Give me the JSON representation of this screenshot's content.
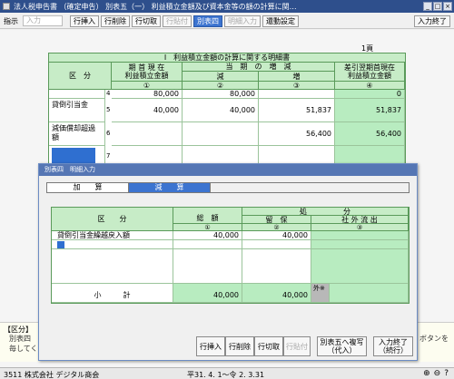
{
  "window": {
    "title": "法人税申告書 （確定申告） 別表五（一） 利益積立金額及び資本金等の額の計算に関…",
    "controls": [
      "_",
      "□",
      "×"
    ]
  },
  "toolbar": {
    "display_label": "指示",
    "input_placeholder": "入力",
    "buttons": [
      {
        "label": "行挿入",
        "state": "normal"
      },
      {
        "label": "行削除",
        "state": "normal"
      },
      {
        "label": "行切取",
        "state": "normal"
      },
      {
        "label": "行貼付",
        "state": "disabled"
      },
      {
        "label": "別表四",
        "state": "active"
      },
      {
        "label": "明細入力",
        "state": "disabled"
      },
      {
        "label": "還動設定",
        "state": "normal"
      }
    ],
    "finish_button": "入力終了"
  },
  "sheet": {
    "page": "1頁",
    "title": "Ⅰ　利益積立金額の計算に関する明細書",
    "headers": {
      "category": "区　分",
      "opening": "期 首 現 在\n利益積立金額",
      "change": "当　期　の　増　減",
      "decrease": "減",
      "increase": "増",
      "closing": "差引翌期首現在\n利益積立金額",
      "col1": "①",
      "col2": "②",
      "col3": "③",
      "col4": "④"
    },
    "rows": [
      {
        "no": "4",
        "label": "",
        "opening": "80,000",
        "decrease": "80,000",
        "increase": "",
        "closing": "0"
      },
      {
        "no": "5",
        "label": "貸倒引当金",
        "opening": "40,000",
        "decrease": "40,000",
        "increase": "51,837",
        "closing": "51,837"
      },
      {
        "no": "6",
        "label": "減価償却超過額",
        "opening": "",
        "decrease": "",
        "increase": "56,400",
        "closing": "56,400"
      },
      {
        "no": "7",
        "label": "",
        "opening": "",
        "decrease": "",
        "increase": "",
        "closing": ""
      }
    ]
  },
  "dialog": {
    "title": "別表四　明細入力",
    "tabs": [
      "加　　算",
      "減　　算"
    ],
    "headers": {
      "category": "区　　分",
      "total": "総　額",
      "disposal": "処　　　　　分",
      "retained": "留　保",
      "outflow": "社 外 流 出",
      "c1": "①",
      "c2": "②",
      "c3": "③"
    },
    "rows": [
      {
        "label": "貸倒引当金繰越戻入額",
        "total": "40,000",
        "retained": "40,000",
        "outflow": ""
      },
      {
        "label": "",
        "total": "",
        "retained": "",
        "outflow": ""
      }
    ],
    "subtotal": {
      "label": "小　　　計",
      "total": "40,000",
      "retained": "40,000",
      "outflow_tag": "外※"
    },
    "buttons": {
      "insert": "行挿入",
      "delete": "行削除",
      "cut": "行切取",
      "paste": "行貼付",
      "transfer": "別表五へ複写\n（代入）",
      "finish": "入力終了\n（続行）"
    }
  },
  "info": {
    "heading": "【区分】",
    "line1": "別表四",
    "line2": "毎してくだ",
    "right": "ボタンを"
  },
  "status": {
    "company": "3511 株式会社 デジタル商会",
    "period": "平31. 4. 1～令 2. 3.31",
    "icons": [
      "zoom-in-icon",
      "zoom-out-icon",
      "help-icon"
    ]
  }
}
